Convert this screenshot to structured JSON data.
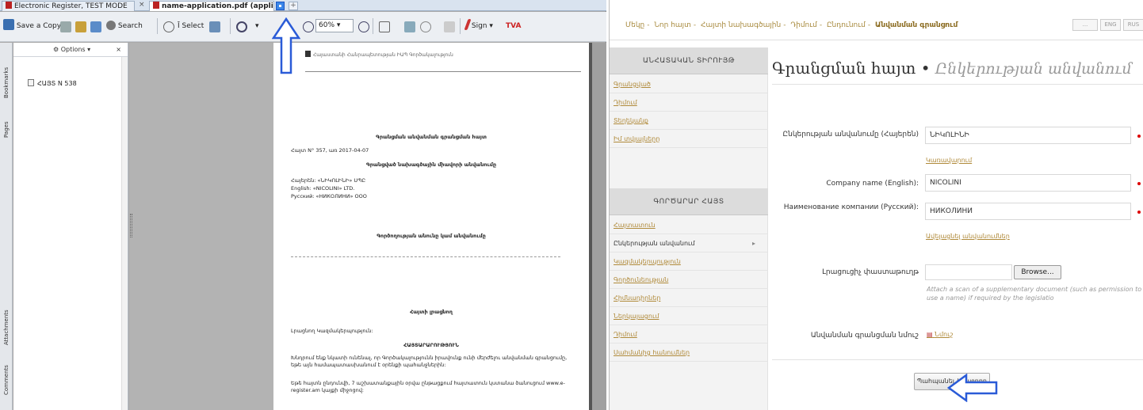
{
  "pdf_viewer": {
    "tabs": [
      {
        "label": "Electronic Register, TEST MODE"
      },
      {
        "label": "name-application.pdf (applica..."
      }
    ],
    "toolbar": {
      "save_copy": "Save a Copy",
      "search": "Search",
      "select": "Select",
      "zoom": "60%",
      "sign": "Sign",
      "tools_badge": "TVA"
    },
    "side_tabs": [
      "Bookmarks",
      "Pages",
      "Attachments",
      "Comments"
    ],
    "bookmarks": {
      "options_label": "Options",
      "close": "×",
      "item": "ՀԱՅՏ N 538"
    },
    "document": {
      "header_text": "Հայաստանի Հանրապետության ԻԱՊ Գործակալություն",
      "heading": "Գրանցման անվանման գրանցման հայտ",
      "request_line": "Հայտ N° 357, առ 2017-04-07",
      "section_title": "Գրանցված նախագծային միավորի անվանումը",
      "names": [
        "Հայերեն: «ՆԻԿՈԼԻՆԻ» ՍՊԸ",
        "English: «NICOLINI» LTD.",
        "Русский: «НИКОЛИНИ» ООО"
      ],
      "prev_name_title": "Գործողության անունը կամ անվանումը",
      "applicant_title": "Հայտի լրացնող",
      "applicant_line": "Լրացնող Կազմակերպություն:",
      "attention_title": "ՀԱՅՏԱՐԱՐՈՒԹՅՈՒՆ",
      "paragraph1": "Խնդրում ենք նկատի ունենալ, որ Գործակալությունն իրավունք ունի մերժելու անվանման գրանցումը, եթե այն համապատասխանում է օրենքի պահանջներին:",
      "paragraph2": "Եթե հայտն ընդունվի, 7 աշխատանքային օրվա ընթացքում հայտատուն կստանա ծանուցում www.e-register.am կայքի միջոցով:"
    }
  },
  "web_form": {
    "breadcrumbs": [
      "Մեկը",
      "Նոր հայտ",
      "Հայտի նախագծային",
      "Դիմում",
      "Ընդունում",
      "Անվանման գրանցում"
    ],
    "top_buttons": [
      "...",
      "ENG",
      "RUS"
    ],
    "sidebar": {
      "sections": [
        {
          "title": "ԱՆՀԱՏԱԿԱՆ ՏԻՐՈՒՅԹ",
          "items": [
            "Գրանցված",
            "Դիմում",
            "Տեղեկանք",
            "Իմ տվյալները"
          ]
        },
        {
          "title": "ԳՈՐԾԱՐԱՐ ՀԱՅՏ",
          "items": [
            "Հայտատուն",
            "Ընկերության անվանում",
            "Կազմակերպություն",
            "Գործունեության",
            "Հիմնադիրներ",
            "Ներկայացում",
            "Դիմում",
            "Սահմանից հանումներ"
          ]
        }
      ],
      "active_item": "Ընկերության անվանում"
    },
    "title": "Գրանցման հայտ",
    "title_sep": "•",
    "subtitle": "Ընկերության անվանում",
    "fields": {
      "armenian_label": "Ընկերության անվանումը (Հայերեն)",
      "armenian_value": "ՆԻԿՈԼԻՆԻ",
      "armenian_link": "Կառավարում",
      "english_label": "Company name (English):",
      "english_value": "NICOLINI",
      "russian_label": "Наименование компании (Русский):",
      "russian_value": "НИКОЛИНИ",
      "russian_link": "Ավելացնել անվանումներ",
      "doc_label": "Լրացուցիչ փաստաթուղթ",
      "browse": "Browse...",
      "hint": "Attach a scan of a supplementary document (such as permission to use a name) if required by the legislatio",
      "sample_label": "Անվանման գրանցման նմուշ",
      "sample_link": "Նմուշ"
    },
    "submit": "Պահպանել / Հաջորդ"
  }
}
